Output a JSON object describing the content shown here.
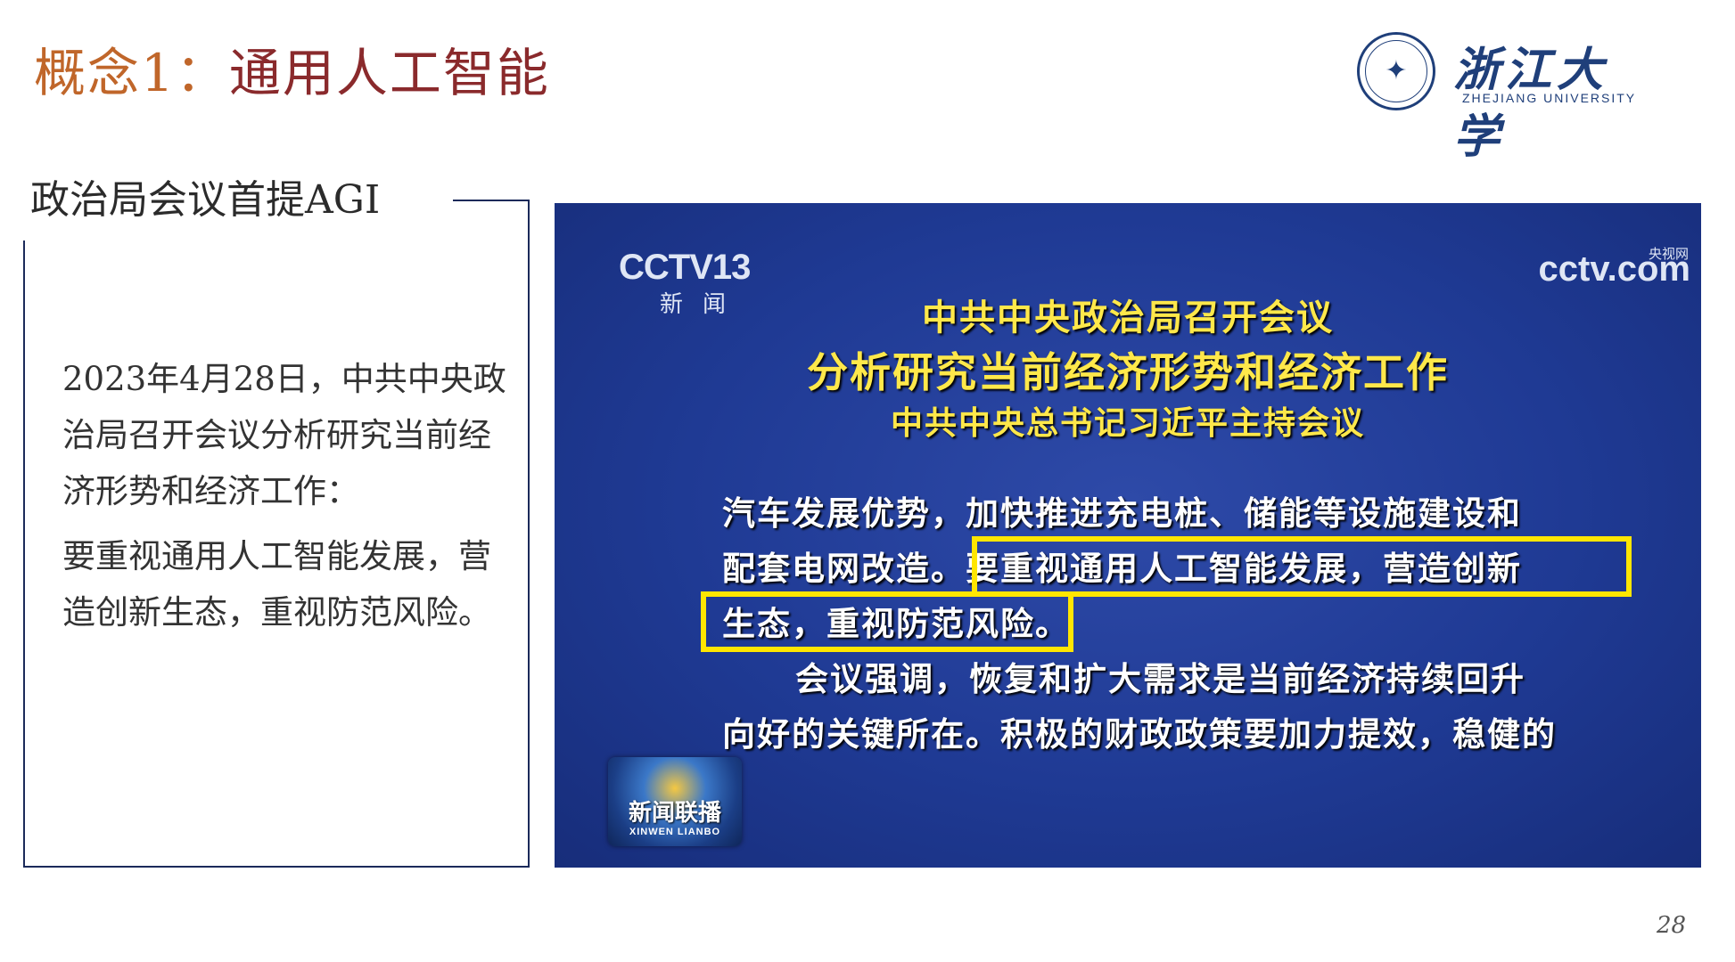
{
  "header": {
    "title_accent": "概念1：",
    "title_main": "通用人工智能"
  },
  "logo": {
    "seal_text": "✦",
    "name_cn": "浙江大学",
    "name_en": "ZHEJIANG UNIVERSITY"
  },
  "section": {
    "label": "政治局会议首提AGI",
    "paragraph1": "2023年4月28日，中共中央政治局召开会议分析研究当前经济形势和经济工作：",
    "paragraph2": "要重视通用人工智能发展，营造创新生态，重视防范风险。"
  },
  "video": {
    "channel_logo": "CCTV13",
    "channel_sub": "新闻",
    "site_logo": "cctv.com",
    "site_tag": "央视网",
    "headline1": "中共中央政治局召开会议",
    "headline2": "分析研究当前经济形势和经济工作",
    "headline3": "中共中央总书记习近平主持会议",
    "line1": "汽车发展优势，加快推进充电桩、储能等设施建设和",
    "line2": "配套电网改造。要重视通用人工智能发展，营造创新",
    "line3": "生态，重视防范风险。",
    "line4": "会议强调，恢复和扩大需求是当前经济持续回升",
    "line5": "向好的关键所在。积极的财政政策要加力提效，稳健的",
    "program_cn": "新闻联播",
    "program_en": "XINWEN LIANBO",
    "highlight_color": "#ffe600"
  },
  "footer": {
    "page_number": "28"
  }
}
